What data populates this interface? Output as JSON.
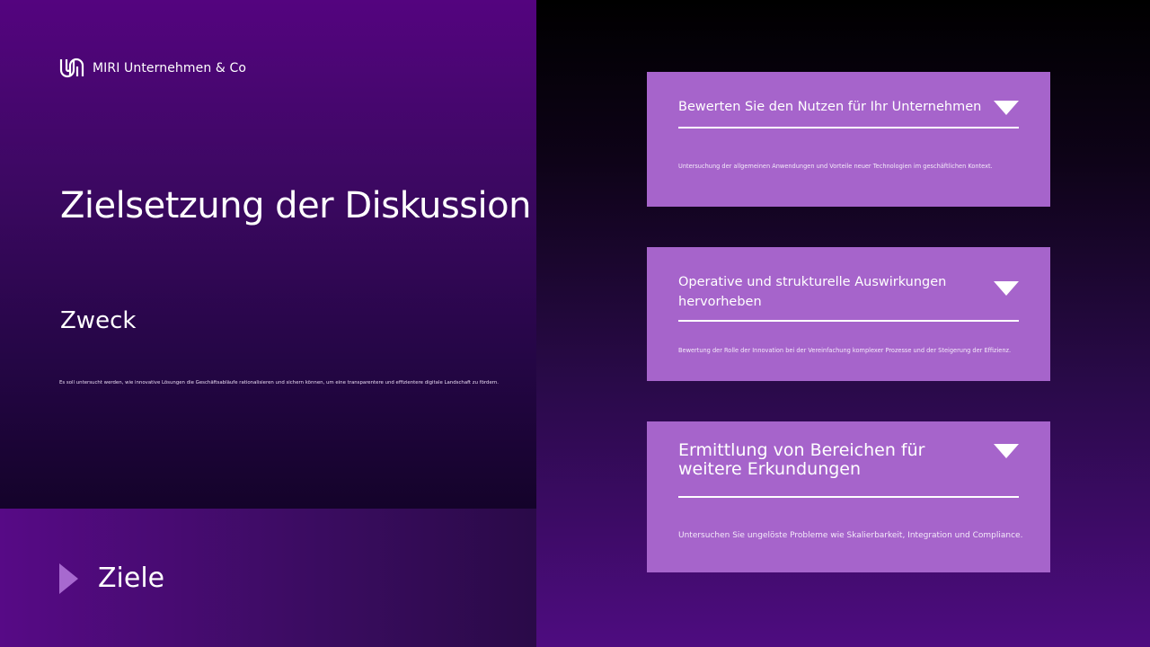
{
  "brand": {
    "name": "MIRI Unternehmen & Co",
    "icon": "logo-icon"
  },
  "main": {
    "title": "Zielsetzung der Diskussion",
    "purpose": {
      "heading": "Zweck",
      "text": "Es soll untersucht werden, wie innovative Lösungen die Geschäftsabläufe rationalisieren und sichern können, um eine transparentere und effizientere digitale Landschaft zu fördern."
    },
    "goals": {
      "label": "Ziele",
      "icon": "play-arrow-icon"
    }
  },
  "cards": [
    {
      "title": "Bewerten Sie den Nutzen für Ihr Unternehmen",
      "text": "Untersuchung der allgemeinen Anwendungen und Vorteile neuer Technologien im geschäftlichen Kontext.",
      "icon": "chevron-down-icon"
    },
    {
      "title": "Operative und strukturelle Auswirkungen hervorheben",
      "text": "Bewertung der Rolle der Innovation bei der Vereinfachung komplexer Prozesse und der Steigerung der Effizienz.",
      "icon": "chevron-down-icon"
    },
    {
      "title": "Ermittlung von Bereichen für weitere Erkundungen",
      "text": "Untersuchen Sie ungelöste Probleme wie Skalierbarkeit, Integration und Compliance.",
      "icon": "chevron-down-icon"
    }
  ],
  "colors": {
    "card": "#a664cb",
    "accent": "#a769cf",
    "panel_top": "#54047f"
  }
}
